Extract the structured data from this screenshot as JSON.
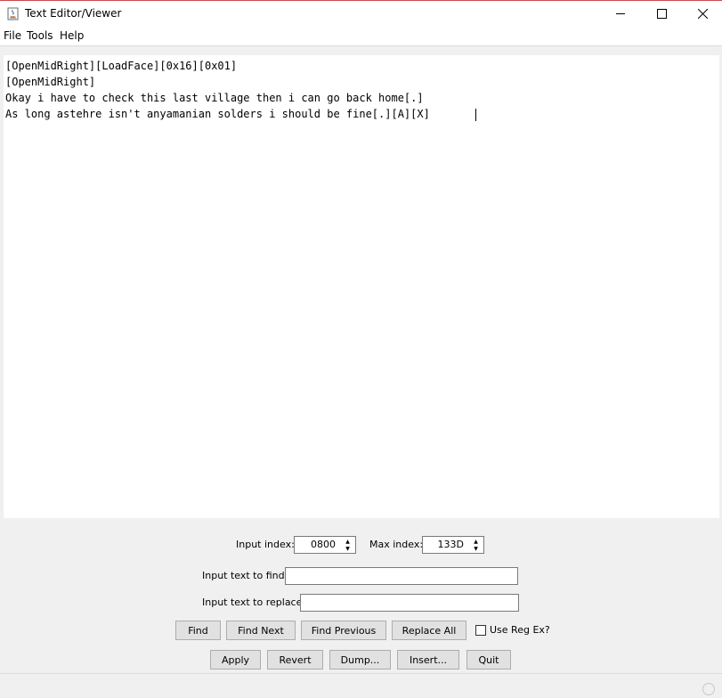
{
  "window": {
    "title": "Text Editor/Viewer",
    "controls": [
      "minimize",
      "maximize",
      "close"
    ]
  },
  "menu": [
    "File",
    "Tools",
    "Help"
  ],
  "editor": {
    "lines": [
      "[OpenMidRight][LoadFace][0x16][0x01]",
      "[OpenMidRight]",
      "Okay i have to check this last village then i can go back home[.]",
      "As long astehre isn't anyamanian solders i should be fine[.][A][X]"
    ]
  },
  "controls": {
    "input_index_label": "Input index:",
    "input_index_value": "0800",
    "max_index_label": "Max index:",
    "max_index_value": "133D",
    "find_label": "Input text to find:",
    "find_value": "",
    "replace_label": "Input text to replace:",
    "replace_value": "",
    "find_button": "Find",
    "find_next_button": "Find Next",
    "find_previous_button": "Find Previous",
    "replace_all_button": "Replace All",
    "use_regex_label": "Use Reg Ex?",
    "use_regex_checked": false,
    "apply_button": "Apply",
    "revert_button": "Revert",
    "dump_button": "Dump...",
    "insert_button": "Insert...",
    "quit_button": "Quit"
  },
  "colors": {
    "window_border": "#c9494b",
    "background": "#f0f0f0",
    "button_face": "#e1e1e1"
  }
}
